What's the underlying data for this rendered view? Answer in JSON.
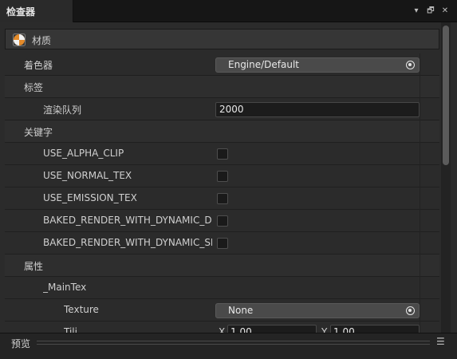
{
  "window": {
    "tab_title": "检查器",
    "menu_icon": "▾",
    "restore_icon": "🗗",
    "close_icon": "✕"
  },
  "material": {
    "header_title": "材质",
    "header_icon": "material-icon",
    "shader": {
      "label": "着色器",
      "value": "Engine/Default"
    },
    "tags": {
      "label": "标签"
    },
    "render_queue": {
      "label": "渲染队列",
      "value": "2000"
    },
    "keywords": {
      "label": "关键字",
      "items": [
        {
          "label": "USE_ALPHA_CLIP",
          "checked": false
        },
        {
          "label": "USE_NORMAL_TEX",
          "checked": false
        },
        {
          "label": "USE_EMISSION_TEX",
          "checked": false
        },
        {
          "label": "BAKED_RENDER_WITH_DYNAMIC_DI",
          "checked": false
        },
        {
          "label": "BAKED_RENDER_WITH_DYNAMIC_SH",
          "checked": false
        }
      ]
    },
    "properties": {
      "label": "属性",
      "main_tex": {
        "label": "_MainTex",
        "texture": {
          "label": "Texture",
          "value": "None"
        },
        "tiling": {
          "label": "Tili",
          "x_label": "X",
          "x_value": "1.00",
          "y_label": "Y",
          "y_value": "1.00"
        }
      }
    }
  },
  "preview": {
    "label": "预览"
  },
  "colors": {
    "accent_icon": "#e38a2a",
    "panel_bg": "#2b2b2b"
  }
}
